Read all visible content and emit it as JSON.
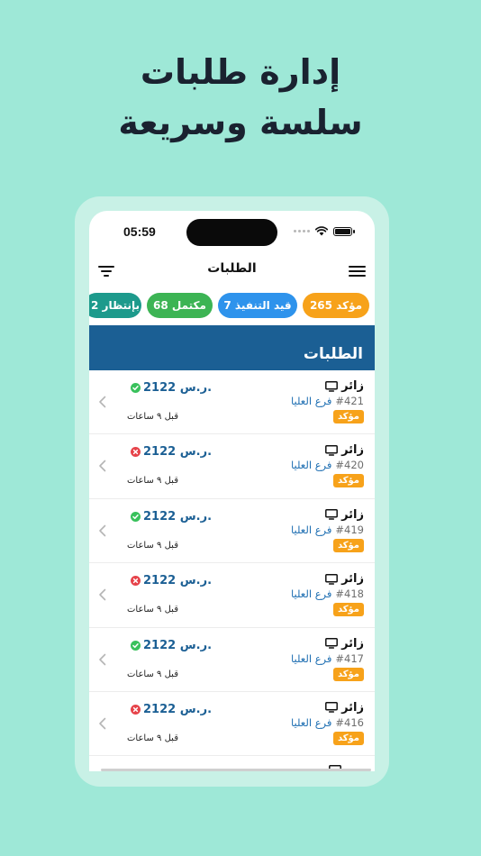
{
  "hero": {
    "line1": "إدارة طلبات",
    "line2": "سلسة وسريعة"
  },
  "status_bar": {
    "time": "05:59"
  },
  "navbar": {
    "title": "الطلبات",
    "left_icon": "filter-icon",
    "right_icon": "menu-icon"
  },
  "chips": {
    "confirmed": "265 مؤكد",
    "processing": "7 قيد التنفيذ",
    "completed": "68 مكتمل",
    "pending": "2 بإنتظار"
  },
  "colors": {
    "background": "#9ee8d7",
    "section": "#1b5f94",
    "confirmed": "#f7a21a",
    "processing": "#2e93ec",
    "completed": "#3cb454",
    "pending": "#1d9a8c"
  },
  "section": {
    "title": "الطلبات"
  },
  "orders": [
    {
      "source": "زائر",
      "id": "#421",
      "branch": "فرع العليا",
      "badge": "مؤكد",
      "amount": "2122 ر.س.",
      "status": "ok",
      "time_ago": "قبل ٩ ساعات"
    },
    {
      "source": "زائر",
      "id": "#420",
      "branch": "فرع العليا",
      "badge": "مؤكد",
      "amount": "2122 ر.س.",
      "status": "err",
      "time_ago": "قبل ٩ ساعات"
    },
    {
      "source": "زائر",
      "id": "#419",
      "branch": "فرع العليا",
      "badge": "مؤكد",
      "amount": "2122 ر.س.",
      "status": "ok",
      "time_ago": "قبل ٩ ساعات"
    },
    {
      "source": "زائر",
      "id": "#418",
      "branch": "فرع العليا",
      "badge": "مؤكد",
      "amount": "2122 ر.س.",
      "status": "err",
      "time_ago": "قبل ٩ ساعات"
    },
    {
      "source": "زائر",
      "id": "#417",
      "branch": "فرع العليا",
      "badge": "مؤكد",
      "amount": "2122 ر.س.",
      "status": "ok",
      "time_ago": "قبل ٩ ساعات"
    },
    {
      "source": "زائر",
      "id": "#416",
      "branch": "فرع العليا",
      "badge": "مؤكد",
      "amount": "2122 ر.س.",
      "status": "err",
      "time_ago": "قبل ٩ ساعات"
    }
  ]
}
